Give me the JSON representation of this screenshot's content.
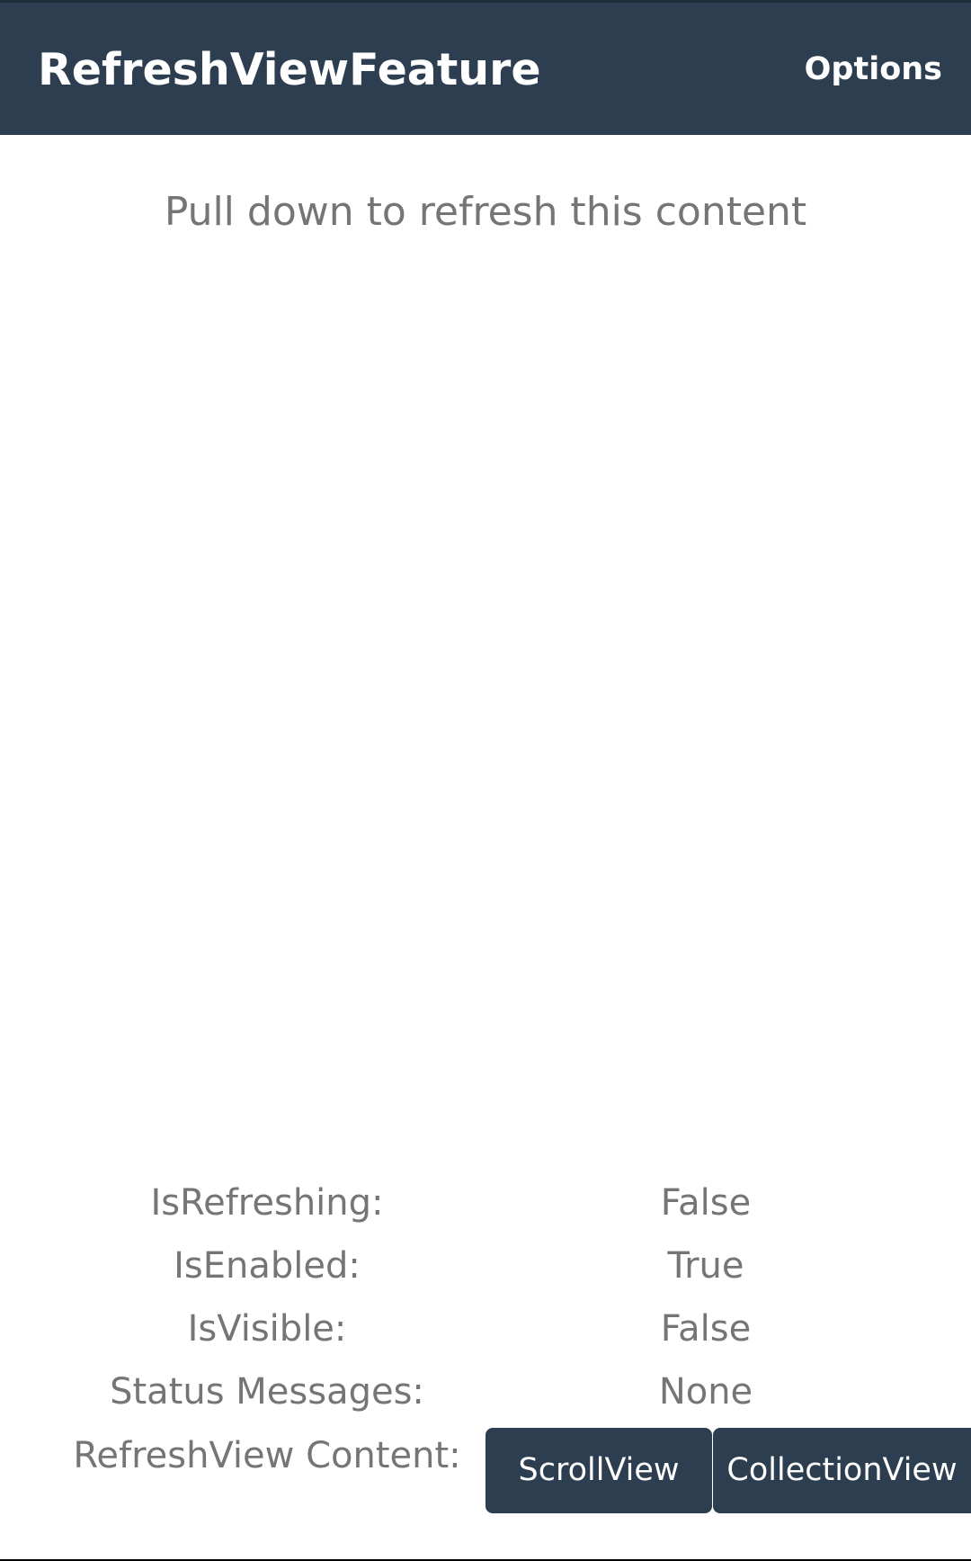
{
  "app_bar": {
    "title": "RefreshViewFeature",
    "options_label": "Options"
  },
  "content": {
    "hint": "Pull down to refresh this content"
  },
  "status": {
    "rows": [
      {
        "label": "IsRefreshing:",
        "value": "False"
      },
      {
        "label": "IsEnabled:",
        "value": "True"
      },
      {
        "label": "IsVisible:",
        "value": "False"
      },
      {
        "label": "Status Messages:",
        "value": "None"
      }
    ],
    "content_label": "RefreshView Content:",
    "buttons": [
      {
        "label": "ScrollView"
      },
      {
        "label": "CollectionView"
      }
    ]
  },
  "colors": {
    "app_bar": "#2d3e50",
    "button": "#2d3e50",
    "text_muted": "#757575",
    "text_on_dark": "#ffffff"
  }
}
